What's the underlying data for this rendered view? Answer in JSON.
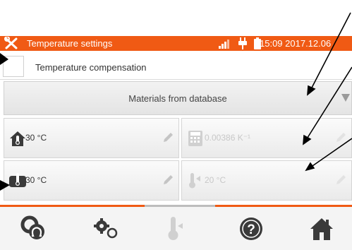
{
  "window": {
    "title": "Temperature settings",
    "datetime": "15:09 2017.12.06"
  },
  "compensation": {
    "label": "Temperature compensation",
    "checked": false
  },
  "materials": {
    "selected": "Materials from database"
  },
  "fields": {
    "measured_temp": "30 °C",
    "coefficient": "0.00386 K⁻¹",
    "object_temp": "30 °C",
    "reference_temp": "20 °C"
  },
  "colors": {
    "accent": "#f05a14",
    "icon_dark": "#3a3a3a",
    "icon_disabled": "#d0d0d0"
  },
  "icons": {
    "title": "tool-icon",
    "status": [
      "signal-icon",
      "plug-icon",
      "battery-icon"
    ],
    "bottom": [
      "resistance-probe-icon",
      "settings-gears-icon",
      "thermometer-icon",
      "help-icon",
      "home-icon"
    ]
  }
}
